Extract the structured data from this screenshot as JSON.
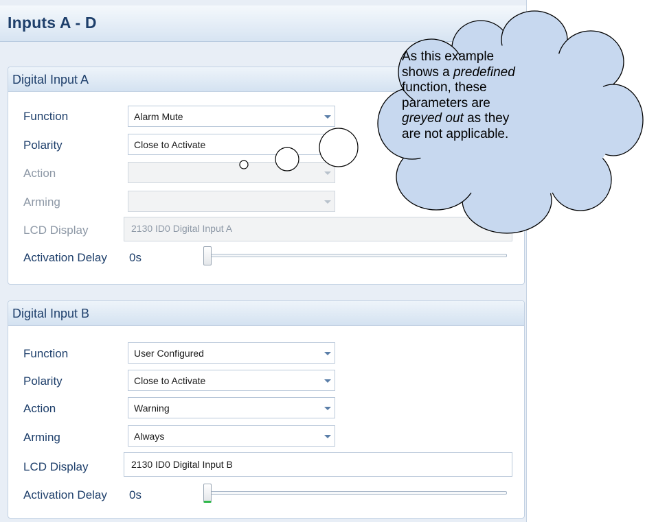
{
  "page": {
    "title": "Inputs A - D"
  },
  "input_a": {
    "header": "Digital Input A",
    "function_label": "Function",
    "function_value": "Alarm Mute",
    "polarity_label": "Polarity",
    "polarity_value": "Close to Activate",
    "action_label": "Action",
    "action_value": "",
    "arming_label": "Arming",
    "arming_value": "",
    "lcd_label": "LCD Display",
    "lcd_value": "2130 ID0 Digital Input A",
    "delay_label": "Activation Delay",
    "delay_value": "0s",
    "delay_level": 0,
    "action_enabled": false,
    "arming_enabled": false,
    "lcd_enabled": false
  },
  "input_b": {
    "header": "Digital Input B",
    "function_label": "Function",
    "function_value": "User Configured",
    "polarity_label": "Polarity",
    "polarity_value": "Close to Activate",
    "action_label": "Action",
    "action_value": "Warning",
    "arming_label": "Arming",
    "arming_value": "Always",
    "lcd_label": "LCD Display",
    "lcd_value": "2130 ID0 Digital Input B",
    "delay_label": "Activation Delay",
    "delay_value": "0s",
    "delay_level": 0
  },
  "callout": {
    "line1": "As this example",
    "line2_a": "shows a ",
    "line2_b": "predefined",
    "line3": "function, these",
    "line4": "parameters are",
    "line5_a": "greyed out",
    "line5_b": " as they",
    "line6": "are not applicable.",
    "fill_color": "#c7d8ef",
    "stroke_color": "#000000"
  },
  "colors": {
    "label_text": "#1e3f6b",
    "disabled_text": "#8d98a6",
    "slider_active": "#2fb84a"
  }
}
